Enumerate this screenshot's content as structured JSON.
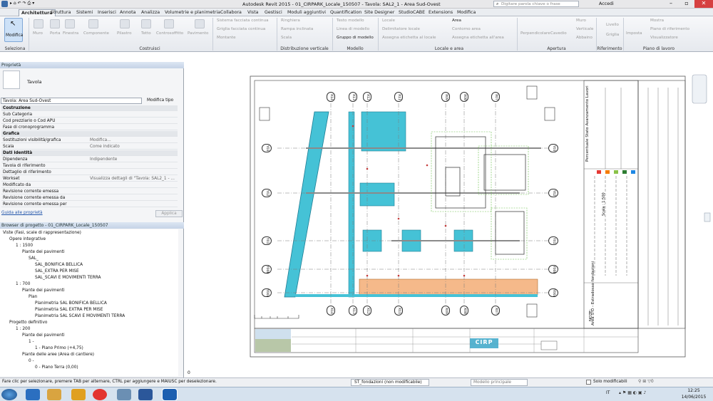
{
  "window": {
    "title": "Autodesk Revit 2015 -   01_CIRPARK_Locale_150507 - Tavola: SAL2_1 - Area Sud-Ovest",
    "search_placeholder": "Digitare parola chiave o frase",
    "sign_in": "Accedi"
  },
  "tabs": [
    "Architettura",
    "Struttura",
    "Sistemi",
    "Inserisci",
    "Annota",
    "Analizza",
    "Volumetrie e planimetria",
    "Collabora",
    "Vista",
    "Gestisci",
    "Moduli aggiuntivi",
    "Quantification",
    "Site Designer",
    "StudioCABE",
    "Extensions",
    "Modifica"
  ],
  "ribbon": {
    "modify": "Modifica",
    "build_tools": [
      "Muro",
      "Porta",
      "Finestra",
      "Componente",
      "Pilastro",
      "Tetto",
      "Controsoffitto",
      "Pavimento"
    ],
    "curtain": [
      "Sistema facciata continua",
      "Griglia facciata continua",
      "Montante"
    ],
    "circulation": [
      "Ringhiera",
      "Rampa inclinata",
      "Scala"
    ],
    "model": [
      "Testo modello",
      "Linea di modello",
      "Gruppo di modello"
    ],
    "room": [
      "Locale",
      "Delimitatore locale",
      "Assegna etichetta al locale",
      "Area",
      "Contorno  area",
      "Assegna etichetta  all'area"
    ],
    "opening": [
      "Perpendicolare",
      "Cavedio",
      "Muro",
      "Verticale",
      "Abbaino"
    ],
    "datum": [
      "Livello",
      "Griglia"
    ],
    "workplane": [
      "Imposta",
      "Mostra",
      "Piano di riferimento",
      "Visualizzatore"
    ],
    "groups": [
      "Seleziona",
      "Costruisci",
      "Distribuzione verticale",
      "Modello",
      "Locale e area",
      "Apertura",
      "Riferimento",
      "Piano di lavoro"
    ]
  },
  "properties": {
    "header": "Proprietà",
    "type_name": "Tavola",
    "selector": "Tavola: Area Sud-Ovest",
    "edit_type": "Modifica tipo",
    "rows": [
      {
        "k": "Costruzione",
        "v": "",
        "section": true
      },
      {
        "k": "Sub Categoria",
        "v": ""
      },
      {
        "k": "Cod prezziario o Cod APU",
        "v": ""
      },
      {
        "k": "Fase di cronoprogramma",
        "v": ""
      },
      {
        "k": "Grafica",
        "v": "",
        "section": true
      },
      {
        "k": "Sostituzioni visibilità/grafica",
        "v": "Modifica..."
      },
      {
        "k": "Scala",
        "v": "Come indicato"
      },
      {
        "k": "Dati identità",
        "v": "",
        "section": true
      },
      {
        "k": "Dipendenza",
        "v": "Indipendente"
      },
      {
        "k": "Tavola di riferimento",
        "v": ""
      },
      {
        "k": "Dettaglio di riferimento",
        "v": ""
      },
      {
        "k": "Workset",
        "v": "Visualizza dettagli di \"Tavola: SAL2_1 - ..."
      },
      {
        "k": "Modificato da",
        "v": ""
      },
      {
        "k": "Revisione corrente emessa",
        "v": ""
      },
      {
        "k": "Revisione corrente emessa da",
        "v": ""
      },
      {
        "k": "Revisione corrente emessa per",
        "v": ""
      }
    ],
    "help": "Guida alle proprietà",
    "apply": "Applica"
  },
  "browser": {
    "header": "Browser di progetto - 01_CIRPARK_Locale_150507",
    "items": [
      {
        "t": "Viste (Fasi, scale di rappresentazione)",
        "d": 0
      },
      {
        "t": "Opere integrative",
        "d": 1
      },
      {
        "t": "1 : 1500",
        "d": 2
      },
      {
        "t": "Piante dei pavimenti",
        "d": 3
      },
      {
        "t": "SAL_",
        "d": 4
      },
      {
        "t": "SAL_BONIFICA BELLICA",
        "d": 5
      },
      {
        "t": "SAL_EXTRA PER MISE",
        "d": 5
      },
      {
        "t": "SAL_SCAVI E MOVIMENTI TERRA",
        "d": 5
      },
      {
        "t": "1 : 700",
        "d": 2
      },
      {
        "t": "Piante dei pavimenti",
        "d": 3
      },
      {
        "t": "Plan",
        "d": 4
      },
      {
        "t": "Planimetria SAL BONIFICA BELLICA",
        "d": 5
      },
      {
        "t": "Planimetria SAL EXTRA PER MISE",
        "d": 5
      },
      {
        "t": "Planimetria SAL SCAVI E MOVIMENTI TERRA",
        "d": 5
      },
      {
        "t": "Progetto definitivo",
        "d": 1
      },
      {
        "t": "1 : 200",
        "d": 2
      },
      {
        "t": "Piante dei pavimenti",
        "d": 3
      },
      {
        "t": "1 -",
        "d": 4
      },
      {
        "t": "1 - Piano Primo (+4,75)",
        "d": 5
      },
      {
        "t": "Piante delle aree (Area di cantiere)",
        "d": 3
      },
      {
        "t": "0 -",
        "d": 4
      },
      {
        "t": "0 - Piano Terra (0,00)",
        "d": 5
      }
    ]
  },
  "drawing": {
    "grids_top": [
      "X14",
      "X13",
      "X12",
      "X11",
      "X09",
      "X08",
      "X07"
    ],
    "grids_side": [
      "Y03",
      "Y02",
      "Y01",
      "Y00b",
      "Y00a"
    ],
    "legend_title": "Percentuale Stato Avanzamento Lavori",
    "sheet_title": "Area S-O - Estradosso fondazioni",
    "scale": "Scala : 1:500",
    "note": "NOTE:",
    "logo": "CIRP"
  },
  "status": {
    "hint": "Fare clic per selezionare, premere TAB per alternare, CTRL per aggiungere e MAIUSC per deselezionare.",
    "workset": "ST_fondazioni (non modificabile)",
    "design_option": "Modello principale",
    "editable_only": "Solo modificabili",
    "scale_zero": "0"
  },
  "taskbar": {
    "lang": "IT",
    "time": "12:25",
    "date": "14/06/2015"
  },
  "colors": {
    "accent": "#3aa6c8",
    "cyan_fill": "#45c2d6",
    "orange_fill": "#f5b98a",
    "legend": [
      "#e53935",
      "#f57c00",
      "#8bc34a",
      "#2e7d32",
      "#1e88e5"
    ]
  }
}
